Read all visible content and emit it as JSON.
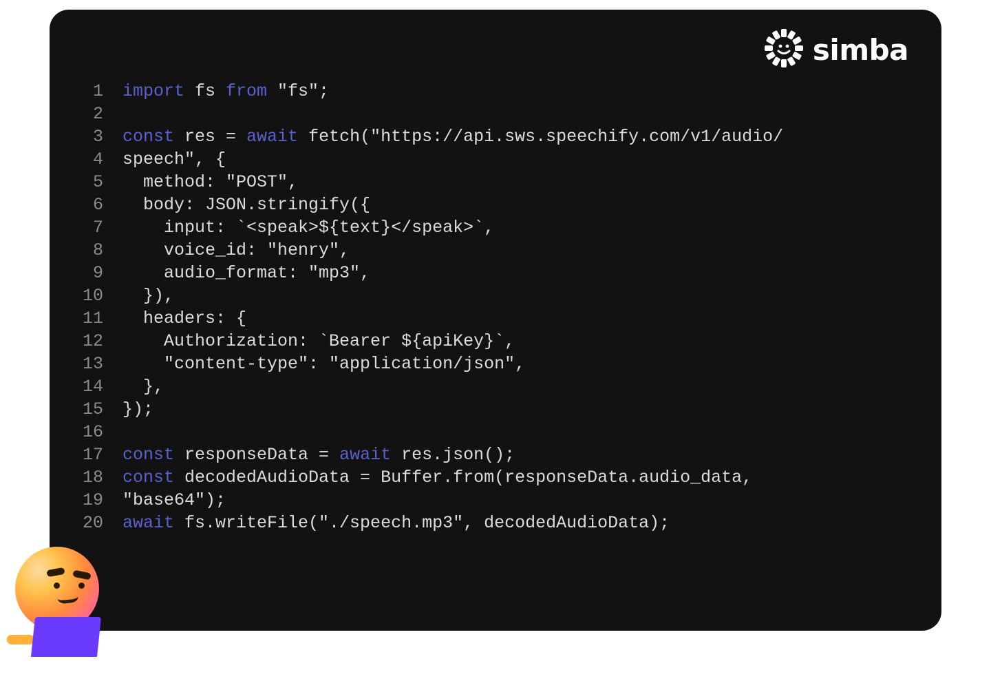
{
  "brand": {
    "name": "simba"
  },
  "code": {
    "lines": [
      {
        "n": "1",
        "segs": [
          {
            "c": "kw",
            "t": "import"
          },
          {
            "t": " fs "
          },
          {
            "c": "kw",
            "t": "from"
          },
          {
            "t": " \"fs\";"
          }
        ]
      },
      {
        "n": "2",
        "segs": [
          {
            "t": ""
          }
        ]
      },
      {
        "n": "3",
        "segs": [
          {
            "c": "kw",
            "t": "const"
          },
          {
            "t": " res = "
          },
          {
            "c": "kw",
            "t": "await"
          },
          {
            "t": " fetch(\"https://api.sws.speechify.com/v1/audio/"
          }
        ]
      },
      {
        "n": "4",
        "segs": [
          {
            "t": "speech\", {"
          }
        ]
      },
      {
        "n": "5",
        "segs": [
          {
            "t": "  method: \"POST\","
          }
        ]
      },
      {
        "n": "6",
        "segs": [
          {
            "t": "  body: JSON.stringify({"
          }
        ]
      },
      {
        "n": "7",
        "segs": [
          {
            "t": "    input: `<speak>${text}</speak>`,"
          }
        ]
      },
      {
        "n": "8",
        "segs": [
          {
            "t": "    voice_id: \"henry\","
          }
        ]
      },
      {
        "n": "9",
        "segs": [
          {
            "t": "    audio_format: \"mp3\","
          }
        ]
      },
      {
        "n": "10",
        "segs": [
          {
            "t": "  }),"
          }
        ]
      },
      {
        "n": "11",
        "segs": [
          {
            "t": "  headers: {"
          }
        ]
      },
      {
        "n": "12",
        "segs": [
          {
            "t": "    Authorization: `Bearer ${apiKey}`,"
          }
        ]
      },
      {
        "n": "13",
        "segs": [
          {
            "t": "    \"content-type\": \"application/json\","
          }
        ]
      },
      {
        "n": "14",
        "segs": [
          {
            "t": "  },"
          }
        ]
      },
      {
        "n": "15",
        "segs": [
          {
            "t": "});"
          }
        ]
      },
      {
        "n": "16",
        "segs": [
          {
            "t": ""
          }
        ]
      },
      {
        "n": "17",
        "segs": [
          {
            "c": "kw",
            "t": "const"
          },
          {
            "t": " responseData = "
          },
          {
            "c": "kw",
            "t": "await"
          },
          {
            "t": " res.json();"
          }
        ]
      },
      {
        "n": "18",
        "segs": [
          {
            "c": "kw",
            "t": "const"
          },
          {
            "t": " decodedAudioData = Buffer.from(responseData.audio_data,"
          }
        ]
      },
      {
        "n": "19",
        "segs": [
          {
            "t": "\"base64\");"
          }
        ]
      },
      {
        "n": "20",
        "segs": [
          {
            "c": "kw",
            "t": "await"
          },
          {
            "t": " fs.writeFile(\"./speech.mp3\", decodedAudioData);"
          }
        ]
      }
    ]
  }
}
